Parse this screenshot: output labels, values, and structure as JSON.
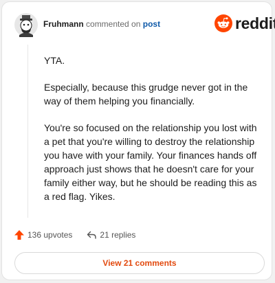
{
  "header": {
    "author": "Fruhmann",
    "action": "commented on",
    "post_link": "post"
  },
  "brand": {
    "logo_text": "reddit",
    "color": "#ff4500"
  },
  "comment": {
    "paragraphs": [
      "YTA.",
      "Especially, because this grudge never got in the way of them helping you financially.",
      "You're so focused on the relationship you lost with a pet that you're willing to destroy the relationship you have with your family. Your finances hands off approach just shows that he doesn't care for your family either way, but he should be reading this as a red flag. Yikes."
    ]
  },
  "actions": {
    "upvotes": "136 upvotes",
    "replies": "21 replies"
  },
  "footer": {
    "view_comments_label": "View 21 comments"
  }
}
